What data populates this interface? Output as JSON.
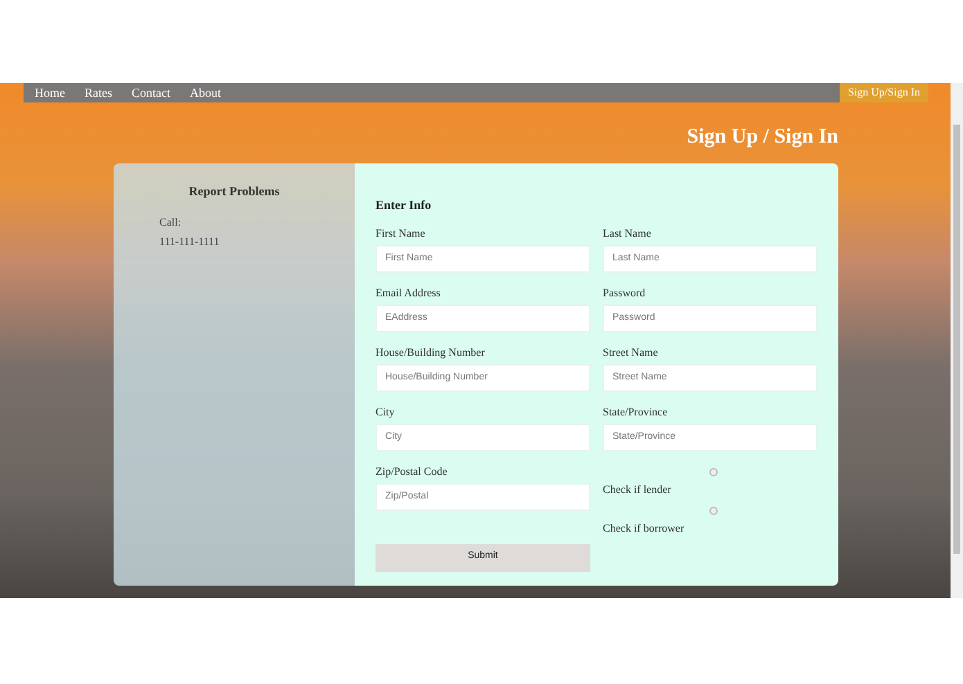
{
  "nav": {
    "links": [
      "Home",
      "Rates",
      "Contact",
      "About"
    ],
    "button": "Sign Up/Sign In"
  },
  "hero_title": "Sign Up / Sign In",
  "report": {
    "title": "Report Problems",
    "call_label": "Call:",
    "phone": "111-111-1111"
  },
  "form": {
    "title": "Enter Info",
    "fields": [
      {
        "label": "First Name",
        "placeholder": "First Name"
      },
      {
        "label": "Last Name",
        "placeholder": "Last Name"
      },
      {
        "label": "Email Address",
        "placeholder": "EAddress"
      },
      {
        "label": "Password",
        "placeholder": "Password"
      },
      {
        "label": "House/Building Number",
        "placeholder": "House/Building Number"
      },
      {
        "label": "Street Name",
        "placeholder": "Street Name"
      },
      {
        "label": "City",
        "placeholder": "City"
      },
      {
        "label": "State/Province",
        "placeholder": "State/Province"
      },
      {
        "label": "Zip/Postal Code",
        "placeholder": "Zip/Postal"
      }
    ],
    "options": [
      {
        "label": "Check if lender",
        "checked": false
      },
      {
        "label": "Check if borrower",
        "checked": false
      }
    ],
    "submit": "Submit"
  }
}
